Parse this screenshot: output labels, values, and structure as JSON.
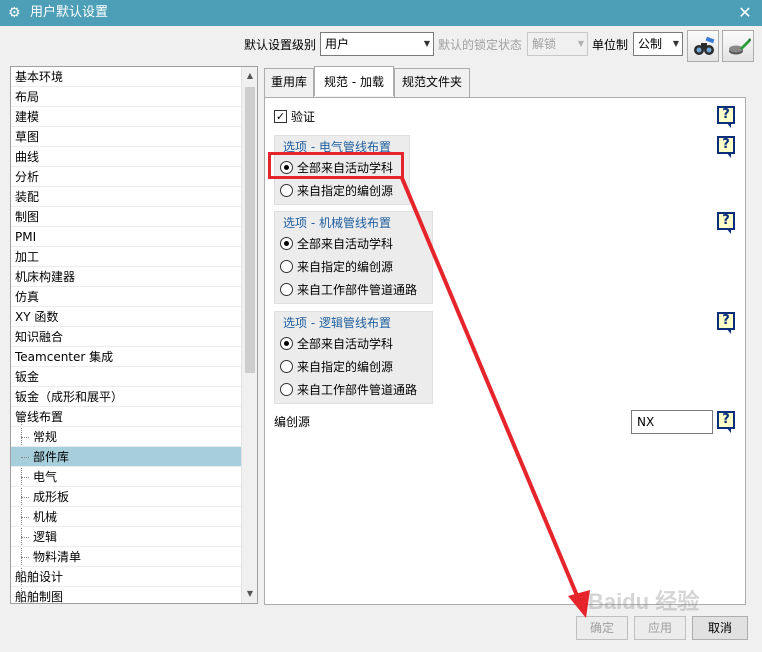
{
  "window": {
    "title": "用户默认设置",
    "close_glyph": "✕"
  },
  "toolbar": {
    "level_label": "默认设置级别",
    "level_value": "用户",
    "lock_label": "默认的锁定状态",
    "lock_value": "解锁",
    "units_label": "单位制",
    "units_value": "公制",
    "find_icon": "binoculars-icon",
    "manage_icon": "edit-defaults-icon"
  },
  "tree": {
    "items": [
      {
        "label": "基本环境"
      },
      {
        "label": "布局"
      },
      {
        "label": "建模"
      },
      {
        "label": "草图"
      },
      {
        "label": "曲线"
      },
      {
        "label": "分析"
      },
      {
        "label": "装配"
      },
      {
        "label": "制图"
      },
      {
        "label": "PMI"
      },
      {
        "label": "加工"
      },
      {
        "label": "机床构建器"
      },
      {
        "label": "仿真"
      },
      {
        "label": "XY 函数"
      },
      {
        "label": "知识融合"
      },
      {
        "label": "Teamcenter 集成"
      },
      {
        "label": "钣金"
      },
      {
        "label": "钣金（成形和展平）"
      },
      {
        "label": "管线布置"
      },
      {
        "label": "常规"
      },
      {
        "label": "部件库"
      },
      {
        "label": "电气"
      },
      {
        "label": "成形板"
      },
      {
        "label": "机械"
      },
      {
        "label": "逻辑"
      },
      {
        "label": "物料清单"
      },
      {
        "label": "船舶设计"
      },
      {
        "label": "船舶制图"
      }
    ],
    "selected_label": "部件库"
  },
  "tabs": [
    {
      "label": "重用库"
    },
    {
      "label": "规范 - 加载"
    },
    {
      "label": "规范文件夹"
    }
  ],
  "active_tab": "规范 - 加载",
  "panel": {
    "verify_label": "验证",
    "verify_checked": true,
    "help_glyph": "?",
    "groups": [
      {
        "title": "选项 - 电气管线布置",
        "options": [
          "全部来自活动学科",
          "来自指定的编创源"
        ],
        "selected": 0
      },
      {
        "title": "选项 - 机械管线布置",
        "options": [
          "全部来自活动学科",
          "来自指定的编创源",
          "来自工作部件管道通路"
        ],
        "selected": 0
      },
      {
        "title": "选项 - 逻辑管线布置",
        "options": [
          "全部来自活动学科",
          "来自指定的编创源",
          "来自工作部件管道通路"
        ],
        "selected": 0
      }
    ],
    "source_label": "编创源",
    "source_value": "NX"
  },
  "buttons": {
    "ok": "确定",
    "apply": "应用",
    "cancel": "取消"
  },
  "colors": {
    "titlebar": "#4d9fb8",
    "selection": "#a7cedb",
    "annotation": "#e5242b",
    "group_title": "#1f5fa0"
  },
  "watermark": {
    "text": "Baidu 经验"
  }
}
